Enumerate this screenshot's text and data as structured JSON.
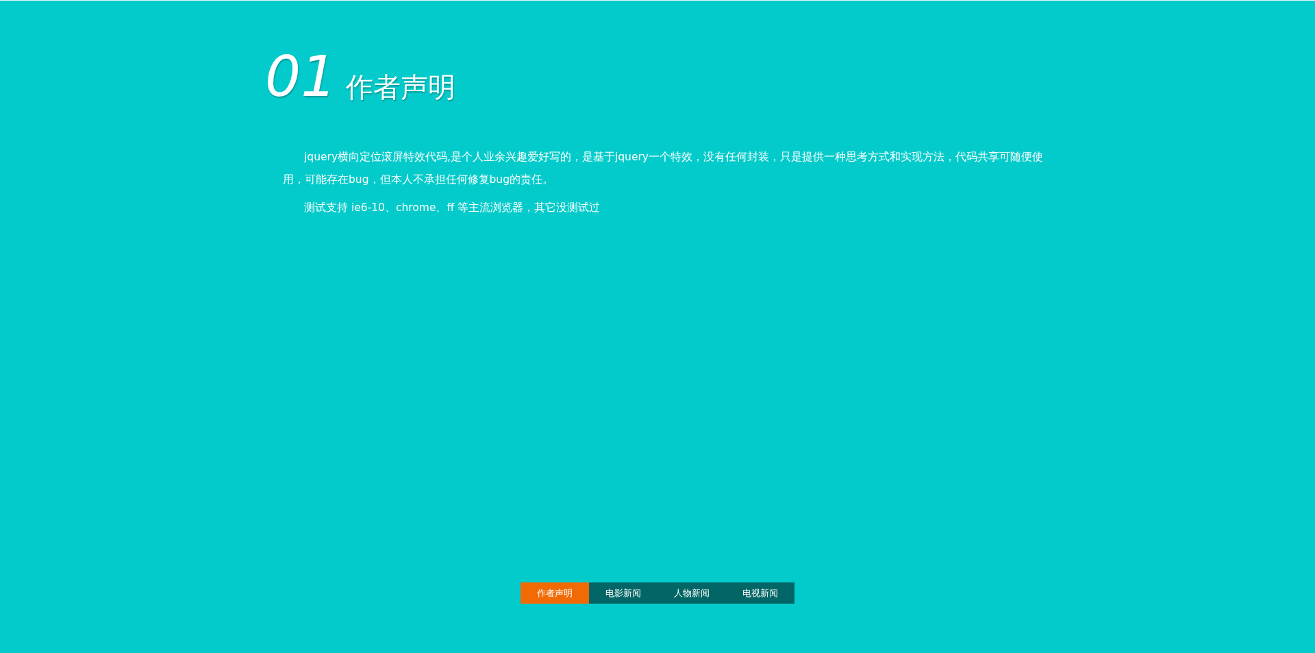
{
  "section": {
    "number": "01",
    "title": "作者声明",
    "paragraphs": [
      "jquery横向定位滚屏特效代码,是个人业余兴趣爱好写的，是基于jquery一个特效，没有任何封装，只是提供一种思考方式和实现方法，代码共享可随便使用，可能存在bug，但本人不承担任何修复bug的责任。",
      "测试支持 ie6-10、chrome、ff 等主流浏览器，其它没测试过"
    ]
  },
  "nav": [
    {
      "label": "作者声明",
      "selected": true
    },
    {
      "label": "电影新闻",
      "selected": false
    },
    {
      "label": "人物新闻",
      "selected": false
    },
    {
      "label": "电视新闻",
      "selected": false
    }
  ]
}
